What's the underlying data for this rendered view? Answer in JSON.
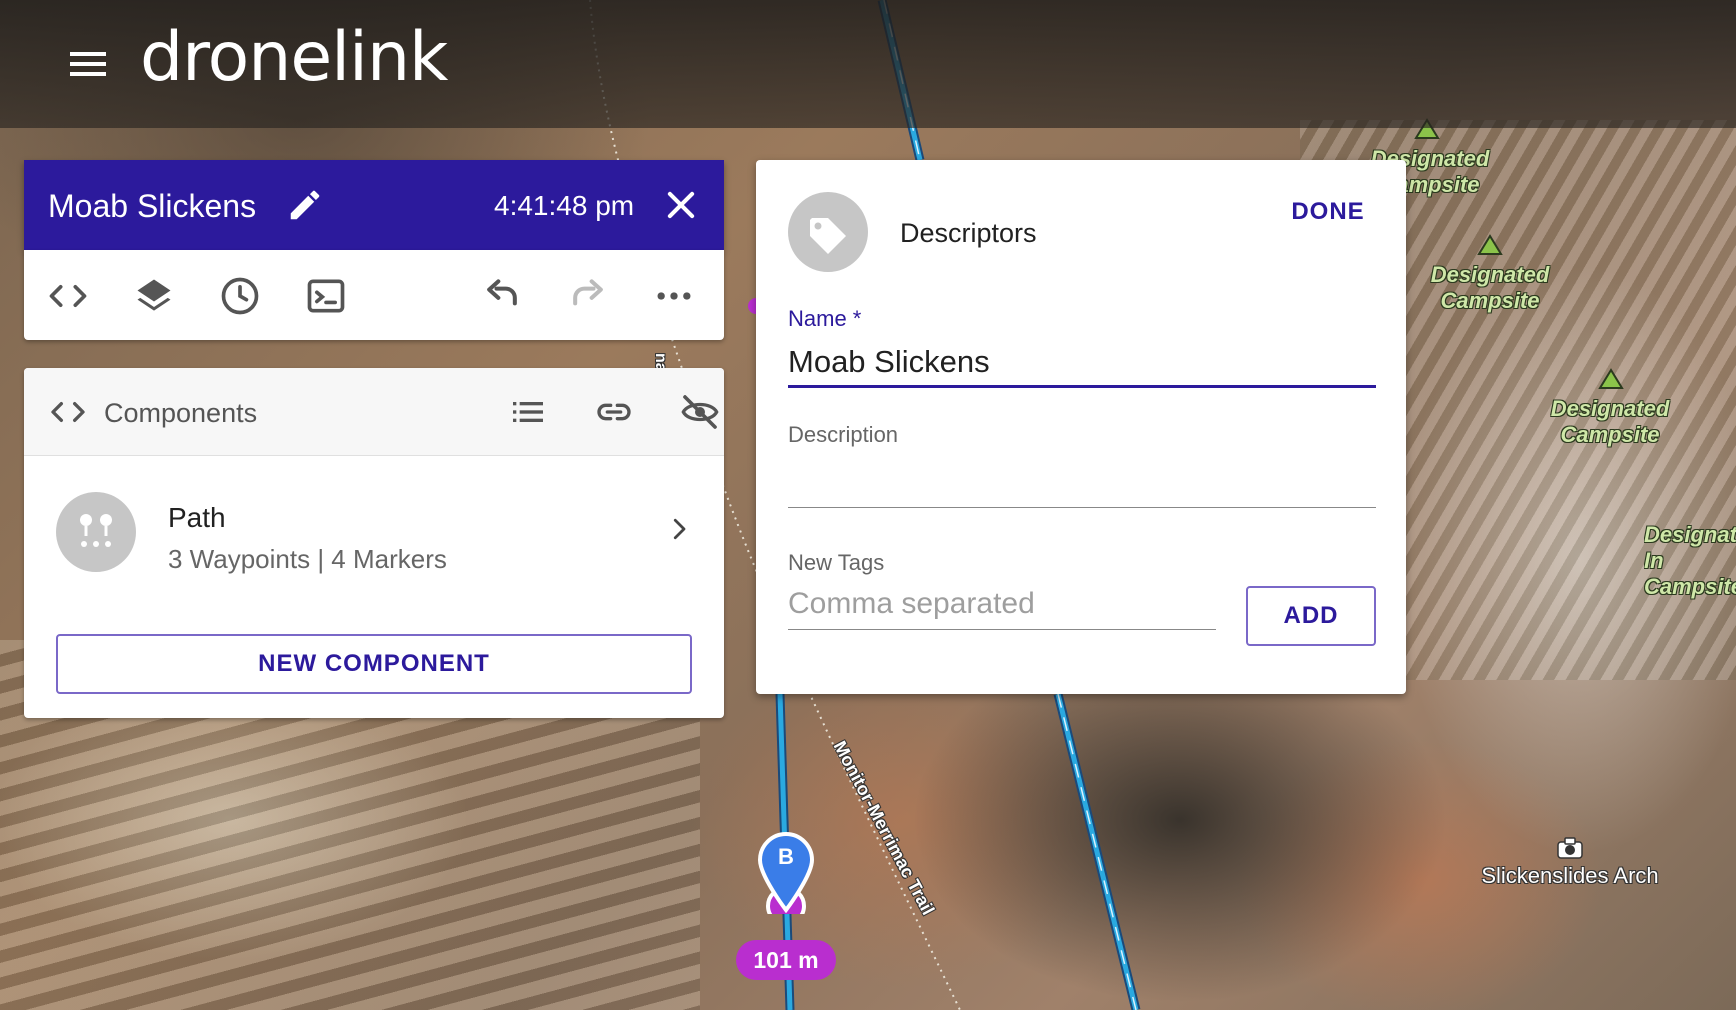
{
  "app": {
    "brand": "dronelink"
  },
  "plan": {
    "title": "Moab Slickens",
    "time": "4:41:48 pm"
  },
  "components": {
    "header": "Components",
    "items": [
      {
        "title": "Path",
        "subtitle": "3 Waypoints | 4 Markers"
      }
    ],
    "new_button": "NEW COMPONENT"
  },
  "descriptors": {
    "title": "Descriptors",
    "done_label": "DONE",
    "name_label": "Name *",
    "name_value": "Moab Slickens",
    "description_label": "Description",
    "description_value": "",
    "tags_label": "New Tags",
    "tags_placeholder": "Comma separated",
    "add_label": "ADD"
  },
  "map": {
    "campsite_labels": [
      "Designated Campsite",
      "Designated Campsite",
      "Designated Campsite",
      "Designated In Campsite"
    ],
    "poi_label": "Slickenslides Arch",
    "trail_label": "Monitor-Merrimac Trail",
    "road_fragment": "nac",
    "marker_letter": "B",
    "distance": "101 m"
  },
  "colors": {
    "primary": "#2c1a9c",
    "path_line": "#2aa9e0",
    "marker_blue": "#3a7de8",
    "marker_purple": "#b92ecf",
    "campsite_green": "#cfe7a8"
  }
}
